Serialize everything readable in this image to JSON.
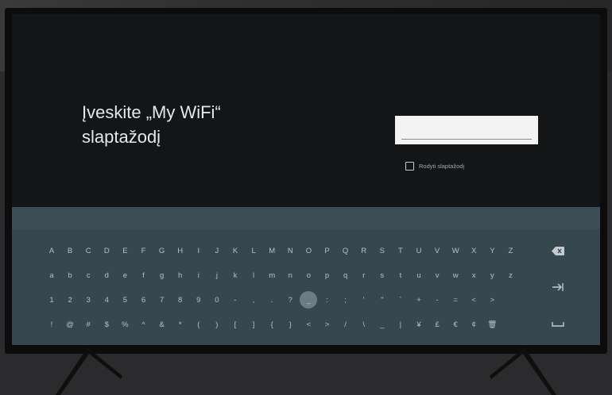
{
  "prompt": {
    "line1": "Įveskite „My WiFi“",
    "line2": "slaptažodį"
  },
  "password_field": {
    "value": "",
    "placeholder": ""
  },
  "show_password": {
    "label": "Rodyti slaptažodį",
    "checked": false
  },
  "keyboard": {
    "uppercase": [
      "A",
      "B",
      "C",
      "D",
      "E",
      "F",
      "G",
      "H",
      "I",
      "J",
      "K",
      "L",
      "M",
      "N",
      "O",
      "P",
      "Q",
      "R",
      "S",
      "T",
      "U",
      "V",
      "W",
      "X",
      "Y",
      "Z"
    ],
    "lowercase": [
      "a",
      "b",
      "c",
      "d",
      "e",
      "f",
      "g",
      "h",
      "i",
      "j",
      "k",
      "l",
      "m",
      "n",
      "o",
      "p",
      "q",
      "r",
      "s",
      "t",
      "u",
      "v",
      "w",
      "x",
      "y",
      "z"
    ],
    "digits": [
      "1",
      "2",
      "3",
      "4",
      "5",
      "6",
      "7",
      "8",
      "9",
      "0",
      "-",
      ",",
      ".",
      "?",
      "_",
      ":",
      ";",
      "'",
      "\"",
      "`",
      "+",
      "-",
      "=",
      "<",
      ">"
    ],
    "symbols": [
      "!",
      "@",
      "#",
      "$",
      "%",
      "^",
      "&",
      "*",
      "(",
      ")",
      "[",
      "]",
      "{",
      "}",
      "<",
      ">",
      "/",
      "\\",
      "_",
      "|",
      "¥",
      "£",
      "€",
      "¢",
      "🗑"
    ],
    "focused_key": "_",
    "backspace_icon": "backspace-icon",
    "enter_icon": "next-arrow-icon",
    "space_icon": "space-bar-icon"
  },
  "colors": {
    "screen_bg": "#141516",
    "keyboard_bg": "#37474f",
    "key_text": "#b7c0c4",
    "focus": "#6b7c84"
  }
}
